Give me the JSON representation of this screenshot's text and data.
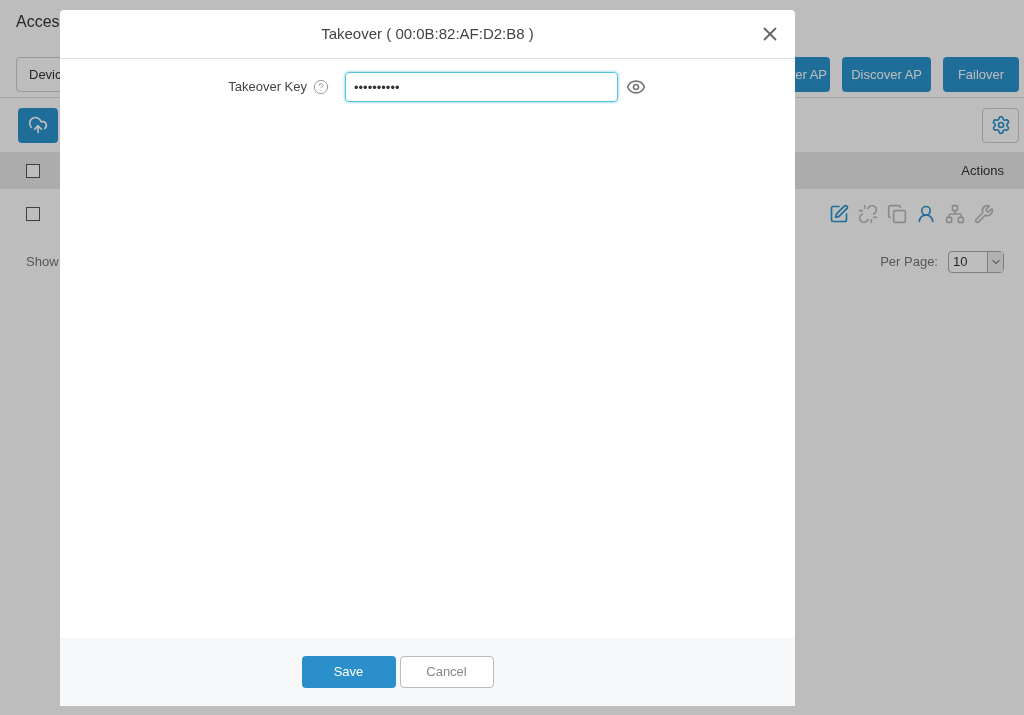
{
  "page": {
    "title": "Acces",
    "device_field": {
      "value": "Devic"
    },
    "buttons": [
      "er AP",
      "Discover AP",
      "Failover"
    ],
    "table": {
      "header_checked": false,
      "columns": [
        "Actions"
      ],
      "rows": [
        {
          "checked": false,
          "actions": [
            {
              "kind": "edit",
              "enabled": true
            },
            {
              "kind": "unlink",
              "enabled": false
            },
            {
              "kind": "screens",
              "enabled": false
            },
            {
              "kind": "person",
              "enabled": true
            },
            {
              "kind": "network",
              "enabled": false
            },
            {
              "kind": "tool",
              "enabled": false
            }
          ]
        }
      ]
    },
    "footer": {
      "showing": "Show",
      "per_page_label": "Per Page:",
      "per_page_value": "10"
    }
  },
  "modal": {
    "title": "Takeover ( 00:0B:82:AF:D2:B8 )",
    "field": {
      "label": "Takeover Key",
      "value": "••••••••••",
      "focused": true
    },
    "buttons": [
      "Save",
      "Cancel"
    ]
  }
}
